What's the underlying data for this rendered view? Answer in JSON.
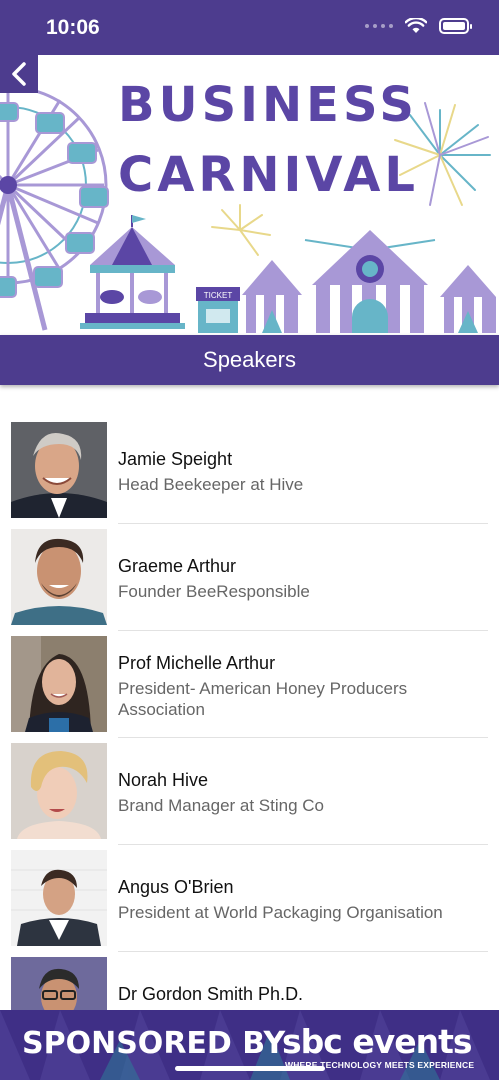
{
  "status_bar": {
    "time": "10:06"
  },
  "banner": {
    "title_line1": "BUSINESS",
    "title_line2": "CARNIVAL",
    "ticket_label": "TICKET"
  },
  "header": {
    "title": "Speakers"
  },
  "speakers": [
    {
      "name": "Jamie Speight",
      "role": "Head Beekeeper at Hive"
    },
    {
      "name": "Graeme Arthur",
      "role": "Founder BeeResponsible"
    },
    {
      "name": "Prof Michelle Arthur",
      "role": " President- American Honey Producers Association"
    },
    {
      "name": "Norah Hive",
      "role": "Brand Manager at Sting Co"
    },
    {
      "name": "Angus O'Brien",
      "role": "President at World Packaging Organisation"
    },
    {
      "name": "Dr Gordon Smith Ph.D.",
      "role": ""
    }
  ],
  "sponsor": {
    "label": "SPONSORED BY",
    "logo": "sbc events",
    "tagline": "WHERE TECHNOLOGY MEETS EXPERIENCE"
  },
  "colors": {
    "brand": "#4d3c8e",
    "title": "#5b46a5",
    "teal": "#67b5c8",
    "lavender": "#a898d6"
  }
}
